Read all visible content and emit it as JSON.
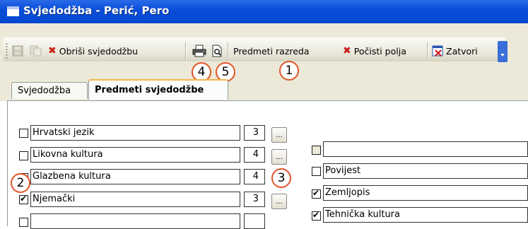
{
  "window": {
    "title": "Svjedodžba - Perić, Pero"
  },
  "toolbar": {
    "delete_label": "Obriši svjedodžbu",
    "subjects_label": "Predmeti razreda",
    "clear_label": "Počisti polja",
    "close_label": "Zatvori"
  },
  "callouts": [
    "1",
    "2",
    "3",
    "4",
    "5"
  ],
  "tabs": [
    {
      "label": "Svjedodžba",
      "active": false
    },
    {
      "label": "Predmeti svjedodžbe",
      "active": true
    }
  ],
  "left_subjects": [
    {
      "name": "Hrvatski jezik",
      "grade": "3",
      "checked": false,
      "button": "..."
    },
    {
      "name": "Likovna kultura",
      "grade": "4",
      "checked": false,
      "button": "..."
    },
    {
      "name": "Glazbena kultura",
      "grade": "4",
      "checked": false,
      "button": ""
    },
    {
      "name": "Njemački",
      "grade": "3",
      "checked": true,
      "button": "..."
    },
    {
      "name": "",
      "grade": "",
      "checked": false,
      "button": ""
    }
  ],
  "right_subjects": [
    {
      "name": "",
      "checked": false
    },
    {
      "name": "Povijest",
      "checked": false
    },
    {
      "name": "Zemljopis",
      "checked": true
    },
    {
      "name": "Tehnička kultura",
      "checked": true
    }
  ]
}
